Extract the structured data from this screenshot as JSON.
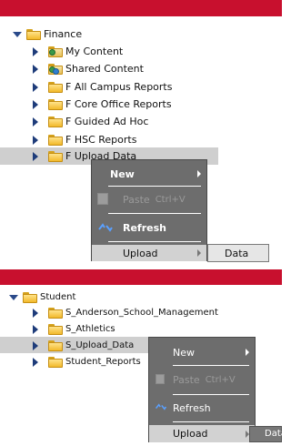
{
  "top": {
    "root_label": "Finance",
    "items": [
      {
        "label": "My Content",
        "icon": "folder-user-icon"
      },
      {
        "label": "Shared Content",
        "icon": "folder-shared-icon"
      },
      {
        "label": "F All Campus Reports",
        "icon": "folder-icon"
      },
      {
        "label": "F Core Office Reports",
        "icon": "folder-icon"
      },
      {
        "label": "F Guided Ad Hoc",
        "icon": "folder-icon"
      },
      {
        "label": "F HSC Reports",
        "icon": "folder-icon"
      },
      {
        "label": "F Upload Data",
        "icon": "folder-icon"
      }
    ],
    "menu": {
      "new": "New",
      "paste": "Paste",
      "paste_shortcut": "Ctrl+V",
      "refresh": "Refresh",
      "upload": "Upload"
    },
    "submenu": {
      "data": "Data"
    }
  },
  "bottom": {
    "root_label": "Student",
    "items": [
      {
        "label": "S_Anderson_School_Management"
      },
      {
        "label": "S_Athletics"
      },
      {
        "label": "S_Upload_Data"
      },
      {
        "label": "Student_Reports"
      }
    ],
    "menu": {
      "new": "New",
      "paste": "Paste",
      "paste_shortcut": "Ctrl+V",
      "refresh": "Refresh",
      "upload": "Upload"
    },
    "submenu": {
      "data": "Data"
    }
  },
  "colors": {
    "header_red": "#c8102e",
    "menu_gray": "#6d6d6d",
    "selection_gray": "#cfcfcf"
  }
}
